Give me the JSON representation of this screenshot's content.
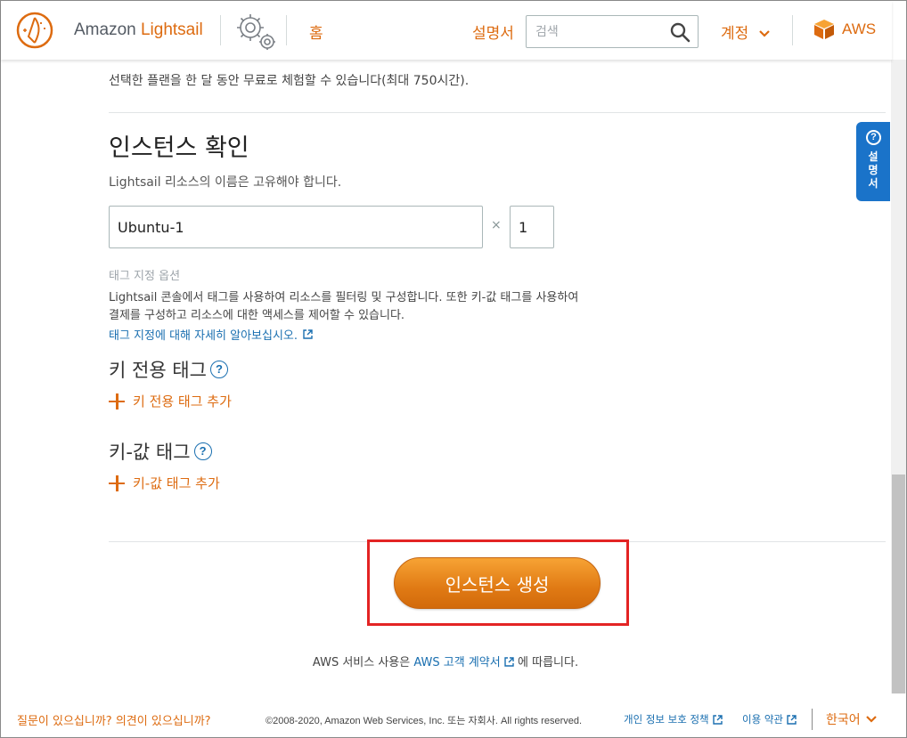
{
  "header": {
    "brand_prefix": "Amazon",
    "brand_name": "Lightsail",
    "home": "홈",
    "docs": "설명서",
    "search_placeholder": "검색",
    "account": "계정",
    "aws": "AWS"
  },
  "help_tab": {
    "label": "설명서"
  },
  "plan": {
    "trial_text": "선택한 플랜을 한 달 동안 무료로 체험할 수 있습니다(최대 750시간)."
  },
  "instance": {
    "title": "인스턴스 확인",
    "description": "Lightsail 리소스의 이름은 고유해야 합니다.",
    "name_value": "Ubuntu-1",
    "times": "×",
    "quantity_value": "1"
  },
  "tags": {
    "heading": "태그 지정 옵션",
    "description_line1": "Lightsail 콘솔에서 태그를 사용하여 리소스를 필터링 및 구성합니다. 또한 키-값 태그를 사용하여",
    "description_line2": "결제를 구성하고 리소스에 대한 액세스를 제어할 수 있습니다.",
    "learn_more": "태그 지정에 대해 자세히 알아보십시오.",
    "key_only_title": "키 전용 태그",
    "key_only_add": "키 전용 태그 추가",
    "key_value_title": "키-값 태그",
    "key_value_add": "키-값 태그 추가",
    "help_glyph": "?"
  },
  "create_button": "인스턴스 생성",
  "agreement": {
    "prefix": "AWS 서비스 사용은",
    "link": "AWS 고객 계약서",
    "suffix": "에 따릅니다."
  },
  "footer": {
    "feedback": "질문이 있으십니까? 의견이 있으십니까?",
    "copyright": "©2008-2020, Amazon Web Services, Inc. 또는 자회사. All rights reserved.",
    "privacy": "개인 정보 보호 정책",
    "terms": "이용 약관",
    "language": "한국어"
  },
  "colors": {
    "accent": "#dd6b10",
    "link": "#1a6fb0",
    "highlight": "#e32424",
    "help_tab": "#1a73c9"
  },
  "icons": [
    "lightsail-logo-icon",
    "gear-icon",
    "search-icon",
    "chevron-down-icon",
    "aws-box-icon",
    "help-question-icon",
    "external-link-icon",
    "plus-icon"
  ]
}
